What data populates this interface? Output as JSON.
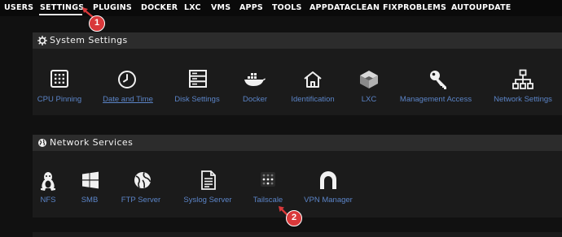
{
  "nav": {
    "items": [
      {
        "label": "USERS"
      },
      {
        "label": "SETTINGS"
      },
      {
        "label": "PLUGINS"
      },
      {
        "label": "DOCKER"
      },
      {
        "label": "LXC"
      },
      {
        "label": "VMS"
      },
      {
        "label": "APPS"
      },
      {
        "label": "TOOLS"
      },
      {
        "label": "APPDATACLEAN"
      },
      {
        "label": "FIXPROBLEMS"
      },
      {
        "label": "AUTOUPDATE"
      }
    ],
    "active": "SETTINGS"
  },
  "system_settings": {
    "title": "System Settings",
    "icon": "gear-icon",
    "tiles": [
      {
        "label": "CPU Pinning",
        "icon": "cpu-icon"
      },
      {
        "label": "Date and Time",
        "icon": "clock-icon"
      },
      {
        "label": "Disk Settings",
        "icon": "disk-icon"
      },
      {
        "label": "Docker",
        "icon": "docker-whale-icon"
      },
      {
        "label": "Identification",
        "icon": "home-icon"
      },
      {
        "label": "LXC",
        "icon": "lxc-cubes-icon"
      },
      {
        "label": "Management Access",
        "icon": "key-icon"
      },
      {
        "label": "Network Settings",
        "icon": "network-tree-icon"
      }
    ]
  },
  "network_services": {
    "title": "Network Services",
    "icon": "globe-icon",
    "tiles": [
      {
        "label": "NFS",
        "icon": "linux-penguin-icon"
      },
      {
        "label": "SMB",
        "icon": "windows-icon"
      },
      {
        "label": "FTP Server",
        "icon": "globe-ball-icon"
      },
      {
        "label": "Syslog Server",
        "icon": "document-icon"
      },
      {
        "label": "Tailscale",
        "icon": "tailscale-dots-icon"
      },
      {
        "label": "VPN Manager",
        "icon": "vpn-arch-icon"
      }
    ]
  },
  "annotations": [
    {
      "label": "1"
    },
    {
      "label": "2"
    }
  ],
  "colors": {
    "background": "#111111",
    "panel": "#1b1b1b",
    "panel_header": "#2c2c2c",
    "link": "#5b84c7",
    "badge": "#d9383a"
  }
}
